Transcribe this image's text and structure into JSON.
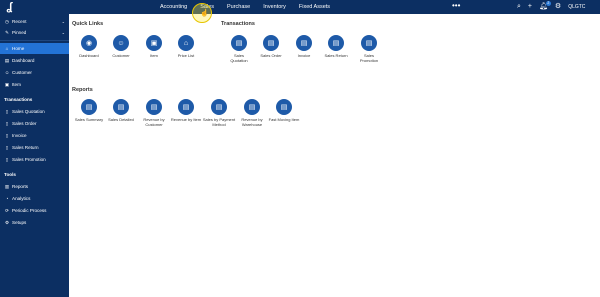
{
  "topbar": {
    "nav": [
      "Accounting",
      "Sales",
      "Purchase",
      "Inventory",
      "Fixed Assets"
    ],
    "more": "•••",
    "notification_count": "2",
    "user": "QLGTC"
  },
  "sidebar": {
    "recent": "Recent",
    "pinned": "Pinned",
    "main_items": [
      "Home",
      "Dashboard",
      "Customer",
      "Item"
    ],
    "transactions_heading": "Transactions",
    "transactions": [
      "Sales Quotation",
      "Sales Order",
      "Invoice",
      "Sales Return",
      "Sales Promotion"
    ],
    "tools_heading": "Tools",
    "tools": [
      "Reports",
      "Analytics",
      "Periodic Process",
      "Setups"
    ]
  },
  "main": {
    "quick_links_title": "Quick Links",
    "quick_links": [
      "Dashboard",
      "Customer",
      "Item",
      "Price List"
    ],
    "transactions_title": "Transactions",
    "transactions": [
      [
        "Sales",
        "Quotation"
      ],
      [
        "Sales Order",
        ""
      ],
      [
        "Invoice",
        ""
      ],
      [
        "Sales Return",
        ""
      ],
      [
        "Sales",
        "Promotion"
      ]
    ],
    "reports_title": "Reports",
    "reports": [
      [
        "Sales Summary",
        ""
      ],
      [
        "Sales Detailed",
        ""
      ],
      [
        "Revenue by",
        "Customer"
      ],
      [
        "Revenue by Item",
        ""
      ],
      [
        "Sales by Payment",
        "Method"
      ],
      [
        "Revenue by",
        "Warehouse"
      ],
      [
        "Fast Moving Item",
        ""
      ]
    ]
  },
  "colors": {
    "navy": "#0c2f62",
    "active": "#2373d6",
    "icon_blue": "#1e5aa8"
  }
}
